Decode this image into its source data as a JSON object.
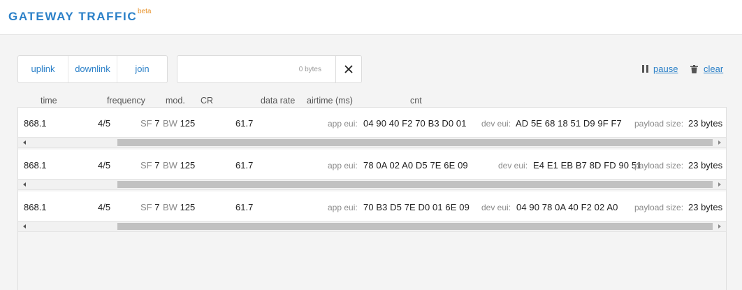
{
  "header": {
    "title": "GATEWAY TRAFFIC",
    "badge": "beta"
  },
  "filters": {
    "uplink": "uplink",
    "downlink": "downlink",
    "join": "join"
  },
  "search": {
    "placeholder": "0 bytes",
    "value": ""
  },
  "actions": {
    "pause": "pause",
    "clear": "clear"
  },
  "columns": {
    "time": "time",
    "frequency": "frequency",
    "mod": "mod.",
    "cr": "CR",
    "data_rate": "data rate",
    "airtime": "airtime (ms)",
    "cnt": "cnt"
  },
  "labels": {
    "sf": "SF",
    "bw": "BW",
    "app_eui": "app eui:",
    "dev_eui": "dev eui:",
    "payload_size": "payload size:"
  },
  "rows": [
    {
      "frequency": "868.1",
      "cr": "4/5",
      "sf": "7",
      "bw": "125",
      "airtime": "61.7",
      "app_eui": "04 90 40 F2 70 B3 D0 01",
      "dev_eui": "AD 5E 68 18 51 D9 9F F7",
      "payload_size": "23 bytes"
    },
    {
      "frequency": "868.1",
      "cr": "4/5",
      "sf": "7",
      "bw": "125",
      "airtime": "61.7",
      "app_eui": "78 0A 02 A0 D5 7E 6E 09",
      "dev_eui": "E4 E1 EB B7 8D FD 90 51",
      "payload_size": "23 bytes"
    },
    {
      "frequency": "868.1",
      "cr": "4/5",
      "sf": "7",
      "bw": "125",
      "airtime": "61.7",
      "app_eui": "70 B3 D5 7E D0 01 6E 09",
      "dev_eui": "04 90 78 0A 40 F2 02 A0",
      "payload_size": "23 bytes"
    }
  ],
  "colors": {
    "accent": "#2b80c8",
    "beta": "#e8922a"
  }
}
